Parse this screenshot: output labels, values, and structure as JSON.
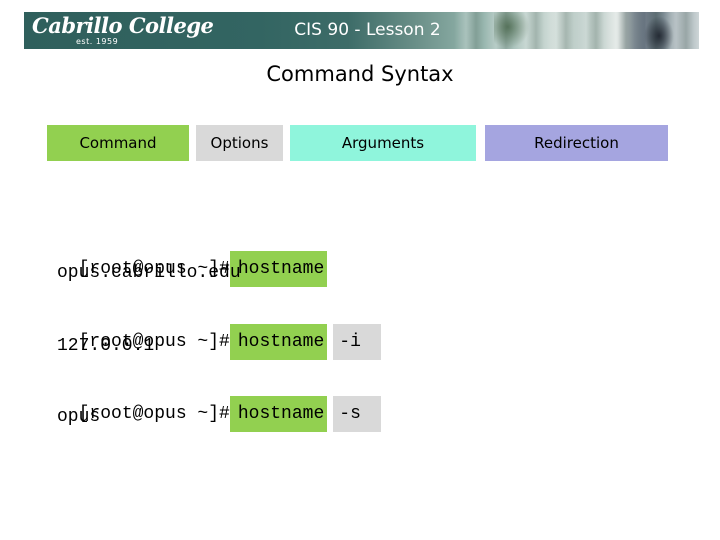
{
  "header": {
    "logo_text": "Cabrillo College",
    "logo_subtext": "est. 1959",
    "title": "CIS 90 - Lesson 2"
  },
  "page": {
    "title": "Command Syntax"
  },
  "syntax_parts": [
    {
      "label": "Command",
      "color": "#92d050"
    },
    {
      "label": "Options",
      "color": "#d9d9d9"
    },
    {
      "label": "Arguments",
      "color": "#8ff5dc"
    },
    {
      "label": "Redirection",
      "color": "#a5a5e0"
    }
  ],
  "examples": [
    {
      "prompt": "[root@opus ~]#",
      "command": "hostname",
      "option": "",
      "output": "opus.cabrillo.edu"
    },
    {
      "prompt": "[root@opus ~]#",
      "command": "hostname",
      "option": "-i",
      "output": "127.0.0.1"
    },
    {
      "prompt": "[root@opus ~]#",
      "command": "hostname",
      "option": "-s",
      "output": "opus"
    }
  ],
  "colors": {
    "header_bg": "#336562",
    "command_highlight": "#92d050",
    "option_highlight": "#d9d9d9"
  }
}
